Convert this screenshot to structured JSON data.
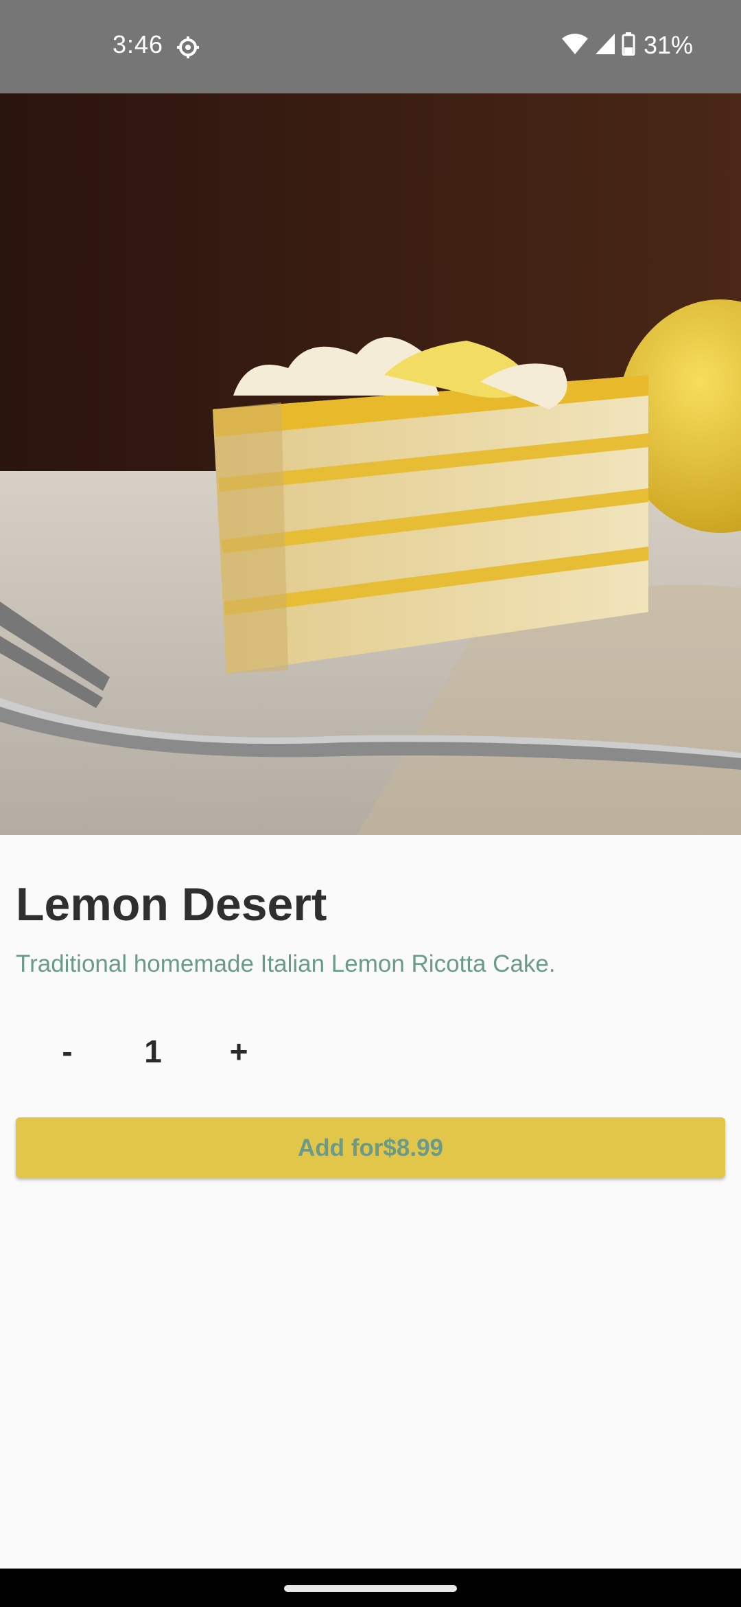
{
  "status_bar": {
    "time": "3:46",
    "battery": "31%",
    "icons": [
      "settings-gear-icon",
      "wifi-icon",
      "cell-signal-icon",
      "battery-icon"
    ]
  },
  "product": {
    "image_icon": "lemon-cake-photo",
    "name": "Lemon Desert",
    "description": "Traditional homemade Italian Lemon Ricotta Cake."
  },
  "quantity": {
    "decrement_label": "-",
    "value": "1",
    "increment_label": "+"
  },
  "add_button": {
    "label": "Add for$8.99"
  },
  "colors": {
    "status_bar": "#767676",
    "accent_button": "#e2c64a",
    "accent_text": "#6a9a8a",
    "title_text": "#2f2f2f",
    "background": "#fafafa"
  }
}
